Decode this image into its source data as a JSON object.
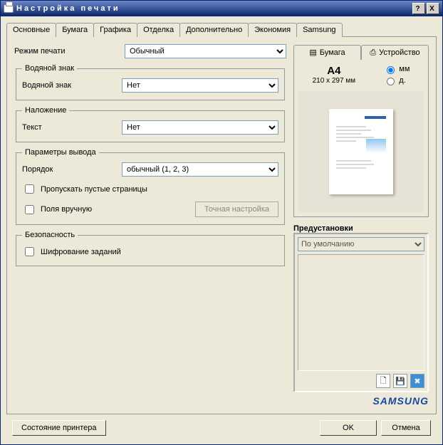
{
  "window": {
    "title": "Настройка печати"
  },
  "tabs": [
    "Основные",
    "Бумага",
    "Графика",
    "Отделка",
    "Дополнительно",
    "Экономия",
    "Samsung"
  ],
  "active_tab_index": 4,
  "print_mode": {
    "label": "Режим печати",
    "value": "Обычный"
  },
  "watermark_group": {
    "legend": "Водяной знак",
    "label": "Водяной знак",
    "value": "Нет"
  },
  "overlay_group": {
    "legend": "Наложение",
    "label": "Текст",
    "value": "Нет"
  },
  "output_group": {
    "legend": "Параметры вывода",
    "order_label": "Порядок",
    "order_value": "обычный (1, 2, 3)",
    "skip_blank": "Пропускать пустые страницы",
    "manual_margins": "Поля вручную",
    "fine_tune_btn": "Точная настройка"
  },
  "security_group": {
    "legend": "Безопасность",
    "encrypt": "Шифрование заданий"
  },
  "right_tabs": {
    "paper": "Бумага",
    "device": "Устройство"
  },
  "paper": {
    "size": "A4",
    "dim": "210 x 297 мм",
    "unit_mm": "мм",
    "unit_in": "д."
  },
  "presets": {
    "label": "Предустановки",
    "value": "По умолчанию"
  },
  "brand": "SAMSUNG",
  "bottom": {
    "printer_status": "Состояние принтера",
    "ok": "OK",
    "cancel": "Отмена"
  }
}
